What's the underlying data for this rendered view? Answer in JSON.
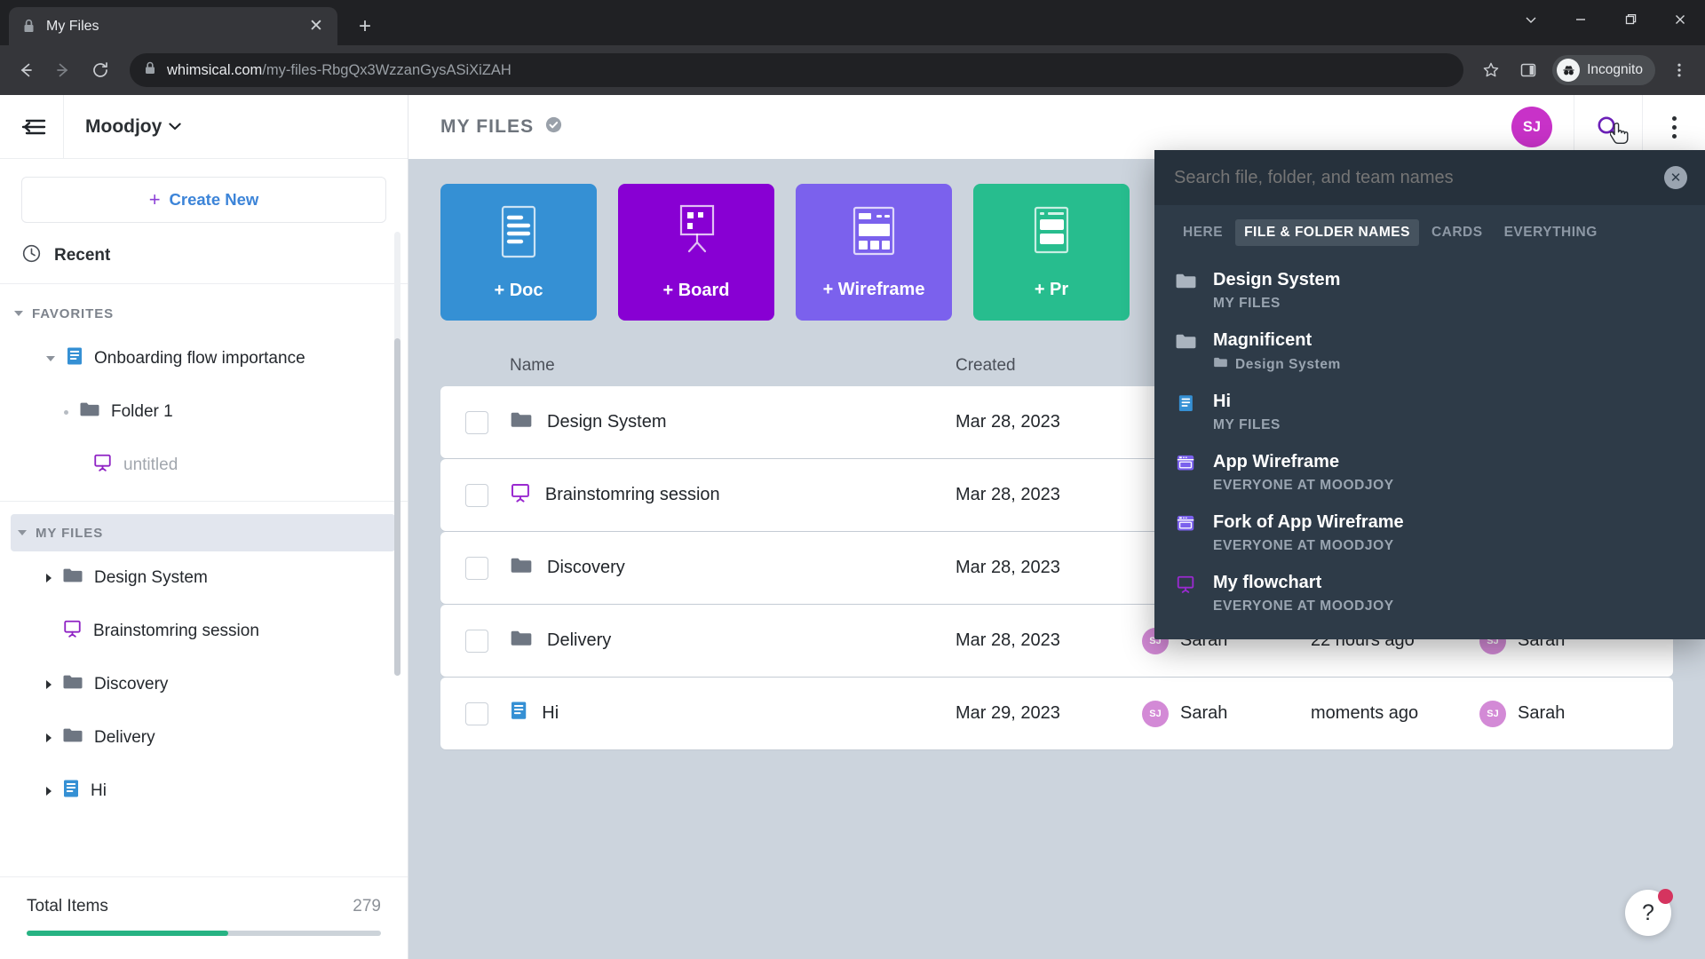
{
  "browser": {
    "tab_title": "My Files",
    "tab_favicon_icon": "lock-icon",
    "tab_close_icon": "close-icon",
    "new_tab_icon": "plus-icon",
    "window_controls": [
      "chevron-down-icon",
      "minimize-icon",
      "maximize-icon",
      "close-icon"
    ],
    "back_icon": "arrow-left-icon",
    "forward_icon": "arrow-right-icon",
    "reload_icon": "reload-icon",
    "lock_icon": "lock-icon",
    "url_domain": "whimsical.com",
    "url_path": "/my-files-RbgQx3WzzanGysASiXiZAH",
    "bookmark_icon": "star-icon",
    "sidepanel_icon": "side-panel-icon",
    "incognito_label": "Incognito",
    "incognito_icon": "incognito-icon",
    "menu_icon": "kebab-menu-icon"
  },
  "sidebar": {
    "collapse_icon": "collapse-sidebar-icon",
    "team_name": "Moodjoy",
    "team_caret_icon": "chevron-down-icon",
    "create_new_label": "Create New",
    "create_new_icon": "plus-icon",
    "recent_label": "Recent",
    "recent_icon": "clock-icon",
    "favorites": {
      "header": "FAVORITES",
      "items": [
        {
          "label": "Onboarding flow importance",
          "icon": "doc-icon",
          "caret": "down",
          "indent": 1
        },
        {
          "label": "Folder 1",
          "icon": "folder-icon",
          "caret": "dot",
          "indent": 2
        },
        {
          "label": "untitled",
          "icon": "board-icon",
          "caret": "none",
          "indent": 3,
          "muted": true
        }
      ]
    },
    "my_files": {
      "header": "MY FILES",
      "items": [
        {
          "label": "Design System",
          "icon": "folder-icon",
          "caret": "right",
          "indent": 1
        },
        {
          "label": "Brainstomring session",
          "icon": "board-icon",
          "caret": "none",
          "indent": 1
        },
        {
          "label": "Discovery",
          "icon": "folder-icon",
          "caret": "right",
          "indent": 1
        },
        {
          "label": "Delivery",
          "icon": "folder-icon",
          "caret": "right",
          "indent": 1
        },
        {
          "label": "Hi",
          "icon": "doc-icon",
          "caret": "right",
          "indent": 1
        }
      ]
    },
    "footer": {
      "total_items_label": "Total Items",
      "total_items_count": "279",
      "progress_percent": 57
    }
  },
  "main": {
    "page_title": "MY FILES",
    "page_title_badge_icon": "verified-check-icon",
    "avatar_initials": "SJ",
    "search_icon": "search-icon",
    "menu_icon": "kebab-menu-icon",
    "cursor_icon": "hand-pointer-cursor",
    "create_cards": [
      {
        "label": "+ Doc",
        "icon": "doc-icon",
        "color": "#3590d4"
      },
      {
        "label": "+ Board",
        "icon": "board-icon",
        "color": "#8800d3"
      },
      {
        "label": "+ Wireframe",
        "icon": "wireframe-icon",
        "color": "#7b61ed"
      },
      {
        "label": "+ Pr",
        "icon": "project-icon",
        "color": "#27bd8e"
      }
    ],
    "table": {
      "columns": [
        "Name",
        "Created"
      ],
      "rows": [
        {
          "name": "Design System",
          "icon": "folder-icon",
          "created": "Mar 28, 2023",
          "created_by": "",
          "modified": "",
          "modified_by": "",
          "avatar": ""
        },
        {
          "name": "Brainstomring session",
          "icon": "board-icon",
          "created": "Mar 28, 2023",
          "created_by": "",
          "modified": "",
          "modified_by": "",
          "avatar": ""
        },
        {
          "name": "Discovery",
          "icon": "folder-icon",
          "created": "Mar 28, 2023",
          "created_by": "",
          "modified": "",
          "modified_by": "",
          "avatar": ""
        },
        {
          "name": "Delivery",
          "icon": "folder-icon",
          "created": "Mar 28, 2023",
          "created_by": "Sarah",
          "modified": "22 hours ago",
          "modified_by": "Sarah",
          "avatar": "SJ"
        },
        {
          "name": "Hi",
          "icon": "doc-icon",
          "created": "Mar 29, 2023",
          "created_by": "Sarah",
          "modified": "moments ago",
          "modified_by": "Sarah",
          "avatar": "SJ"
        }
      ]
    },
    "help_label": "?",
    "help_icon": "question-mark-icon",
    "help_badge_icon": "notification-dot"
  },
  "search_panel": {
    "placeholder": "Search file, folder, and team names",
    "close_icon": "close-circle-icon",
    "tabs": [
      {
        "label": "HERE",
        "active": false
      },
      {
        "label": "FILE & FOLDER NAMES",
        "active": true
      },
      {
        "label": "CARDS",
        "active": false
      },
      {
        "label": "EVERYTHING",
        "active": false
      }
    ],
    "results": [
      {
        "title": "Design System",
        "icon": "folder-icon",
        "subtitle": "MY FILES",
        "sub_icon": "none"
      },
      {
        "title": "Magnificent",
        "icon": "folder-icon",
        "subtitle": "Design System",
        "sub_icon": "folder-icon"
      },
      {
        "title": "Hi",
        "icon": "doc-icon",
        "subtitle": "MY FILES",
        "sub_icon": "none"
      },
      {
        "title": "App Wireframe",
        "icon": "wireframe-icon",
        "subtitle": "EVERYONE AT MOODJOY",
        "sub_icon": "none"
      },
      {
        "title": "Fork of App Wireframe",
        "icon": "wireframe-icon",
        "subtitle": "EVERYONE AT MOODJOY",
        "sub_icon": "none"
      },
      {
        "title": "My flowchart",
        "icon": "board-icon",
        "subtitle": "EVERYONE AT MOODJOY",
        "sub_icon": "none"
      }
    ]
  },
  "colors": {
    "doc_blue": "#3590d4",
    "board_purple": "#8800d3",
    "wireframe_purple": "#7b61ed",
    "project_green": "#27bd8e",
    "accent_link": "#3c84d8",
    "progress_green": "#27b383",
    "avatar_magenta": "#c832c8",
    "panel_bg": "#2e3b48"
  }
}
